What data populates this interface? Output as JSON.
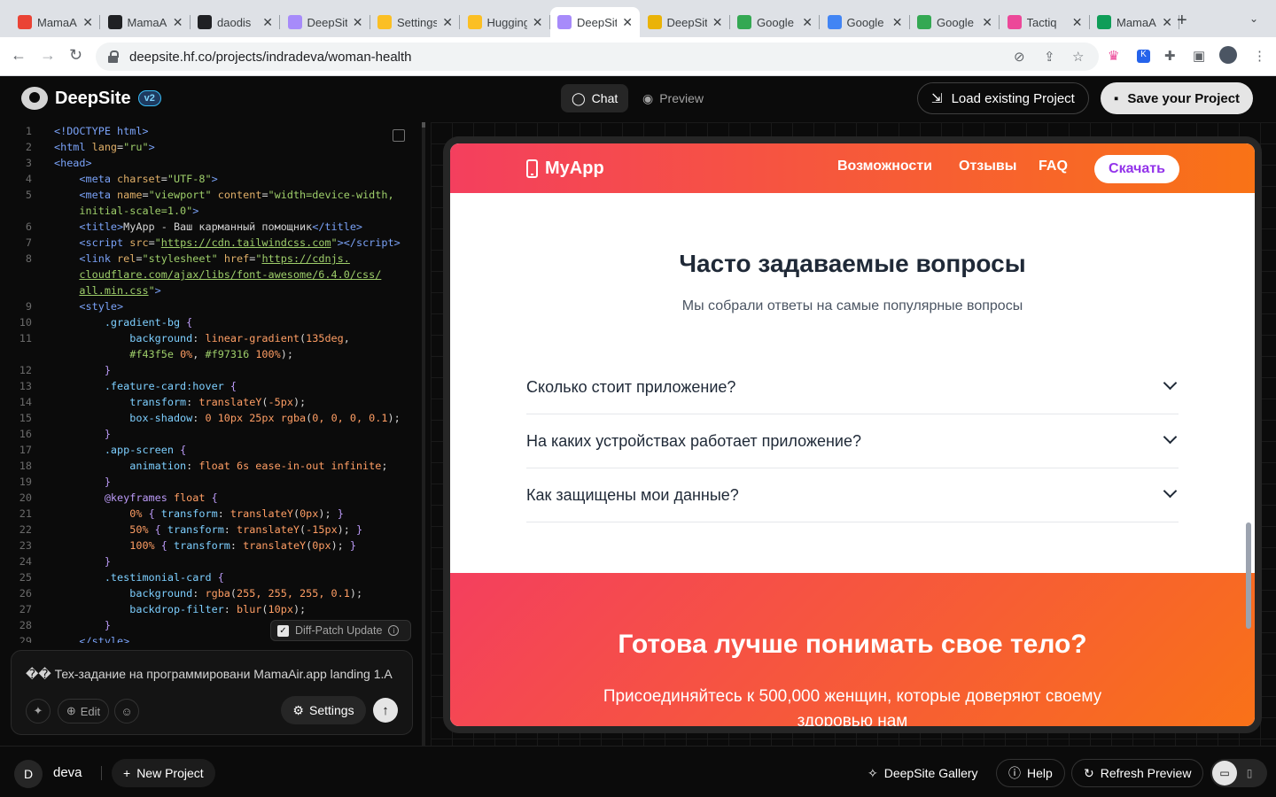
{
  "browser": {
    "tabs": [
      {
        "title": "MamaAir",
        "fav_color": "#ea4335",
        "fav_icon": "figma-icon"
      },
      {
        "title": "MamaAir",
        "fav_color": "#202124",
        "fav_icon": "openai-icon"
      },
      {
        "title": "daodis",
        "fav_color": "#202124",
        "fav_icon": "openai-icon"
      },
      {
        "title": "DeepSite",
        "fav_color": "#a78bfa",
        "fav_icon": "deepsite-icon"
      },
      {
        "title": "Settings",
        "fav_color": "#fbbf24",
        "fav_icon": "huggingface-icon"
      },
      {
        "title": "Hugging Face",
        "fav_color": "#fbbf24",
        "fav_icon": "huggingface-icon"
      },
      {
        "title": "DeepSite",
        "fav_color": "#a78bfa",
        "fav_icon": "deepsite-icon"
      },
      {
        "title": "DeepSite",
        "fav_color": "#eab308",
        "fav_icon": "deepsite-icon"
      },
      {
        "title": "Google Meet",
        "fav_color": "#34a853",
        "fav_icon": "meet-icon"
      },
      {
        "title": "Google Calendar",
        "fav_color": "#4285f4",
        "fav_icon": "calendar-icon"
      },
      {
        "title": "Google Meet",
        "fav_color": "#34a853",
        "fav_icon": "meet-icon"
      },
      {
        "title": "Tactiq",
        "fav_color": "#ec4899",
        "fav_icon": "tactiq-icon"
      },
      {
        "title": "MamaAir",
        "fav_color": "#0f9d58",
        "fav_icon": "drive-icon"
      }
    ],
    "url": "deepsite.hf.co/projects/indradeva/woman-health"
  },
  "app": {
    "name": "DeepSite",
    "version": "v2",
    "chat_label": "Chat",
    "preview_label": "Preview",
    "load_label": "Load existing Project",
    "save_label": "Save your Project"
  },
  "editor": {
    "lines": [
      {
        "n": "1",
        "html": "<span class='ck'>&lt;!DOCTYPE html&gt;</span>"
      },
      {
        "n": "2",
        "html": "<span class='ck'>&lt;html</span> <span class='ca'>lang</span>=<span class='cs'>\"ru\"</span><span class='ck'>&gt;</span>"
      },
      {
        "n": "3",
        "html": "<span class='ck'>&lt;head&gt;</span>"
      },
      {
        "n": "4",
        "html": "    <span class='ck'>&lt;meta</span> <span class='ca'>charset</span>=<span class='cs'>\"UTF-8\"</span><span class='ck'>&gt;</span>"
      },
      {
        "n": "5",
        "html": "    <span class='ck'>&lt;meta</span> <span class='ca'>name</span>=<span class='cs'>\"viewport\"</span> <span class='ca'>content</span>=<span class='cs'>\"width=device-width,</span>"
      },
      {
        "n": "",
        "html": "    <span class='cs'>initial-scale=1.0\"</span><span class='ck'>&gt;</span>"
      },
      {
        "n": "6",
        "html": "    <span class='ck'>&lt;title&gt;</span>MyApp - Ваш карманный помощник<span class='ck'>&lt;/title&gt;</span>"
      },
      {
        "n": "7",
        "html": "    <span class='ck'>&lt;script</span> <span class='ca'>src</span>=<span class='cs'>\"<u>https://cdn.tailwindcss.com</u>\"</span><span class='ck'>&gt;&lt;/script&gt;</span>"
      },
      {
        "n": "8",
        "html": "    <span class='ck'>&lt;link</span> <span class='ca'>rel</span>=<span class='cs'>\"stylesheet\"</span> <span class='ca'>href</span>=<span class='cs'>\"<u>https://cdnjs.</u></span>"
      },
      {
        "n": "",
        "html": "    <span class='cs'><u>cloudflare.com/ajax/libs/font-awesome/6.4.0/css/</u></span>"
      },
      {
        "n": "",
        "html": "    <span class='cs'><u>all.min.css</u>\"</span><span class='ck'>&gt;</span>"
      },
      {
        "n": "9",
        "html": "    <span class='ck'>&lt;style&gt;</span>"
      },
      {
        "n": "10",
        "html": "        <span class='cc'>.gradient-bg</span> <span class='cp'>{</span>"
      },
      {
        "n": "11",
        "html": "            <span class='cc'>background</span>: <span class='cv'>linear-gradient</span>(<span class='cv'>135deg</span>,"
      },
      {
        "n": "",
        "html": "            <span class='cs'>#f43f5e</span> <span class='cv'>0%</span>, <span class='cs'>#f97316</span> <span class='cv'>100%</span>);"
      },
      {
        "n": "12",
        "html": "        <span class='cp'>}</span>"
      },
      {
        "n": "13",
        "html": "        <span class='cc'>.feature-card:hover</span> <span class='cp'>{</span>"
      },
      {
        "n": "14",
        "html": "            <span class='cc'>transform</span>: <span class='cv'>translateY</span>(<span class='cv'>-5px</span>);"
      },
      {
        "n": "15",
        "html": "            <span class='cc'>box-shadow</span>: <span class='cv'>0 10px 25px</span> <span class='cv'>rgba</span>(<span class='cv'>0, 0, 0, 0.1</span>);"
      },
      {
        "n": "16",
        "html": "        <span class='cp'>}</span>"
      },
      {
        "n": "17",
        "html": "        <span class='cc'>.app-screen</span> <span class='cp'>{</span>"
      },
      {
        "n": "18",
        "html": "            <span class='cc'>animation</span>: <span class='cv'>float 6s ease-in-out infinite</span>;"
      },
      {
        "n": "19",
        "html": "        <span class='cp'>}</span>"
      },
      {
        "n": "20",
        "html": "        <span class='cp'>@keyframes</span> <span class='cv'>float</span> <span class='cp'>{</span>"
      },
      {
        "n": "21",
        "html": "            <span class='cv'>0%</span> <span class='cp'>{</span> <span class='cc'>transform</span>: <span class='cv'>translateY</span>(<span class='cv'>0px</span>); <span class='cp'>}</span>"
      },
      {
        "n": "22",
        "html": "            <span class='cv'>50%</span> <span class='cp'>{</span> <span class='cc'>transform</span>: <span class='cv'>translateY</span>(<span class='cv'>-15px</span>); <span class='cp'>}</span>"
      },
      {
        "n": "23",
        "html": "            <span class='cv'>100%</span> <span class='cp'>{</span> <span class='cc'>transform</span>: <span class='cv'>translateY</span>(<span class='cv'>0px</span>); <span class='cp'>}</span>"
      },
      {
        "n": "24",
        "html": "        <span class='cp'>}</span>"
      },
      {
        "n": "25",
        "html": "        <span class='cc'>.testimonial-card</span> <span class='cp'>{</span>"
      },
      {
        "n": "26",
        "html": "            <span class='cc'>background</span>: <span class='cv'>rgba</span>(<span class='cv'>255, 255, 255, 0.1</span>);"
      },
      {
        "n": "27",
        "html": "            <span class='cc'>backdrop-filter</span>: <span class='cv'>blur</span>(<span class='cv'>10px</span>);"
      },
      {
        "n": "28",
        "html": "        <span class='cp'>}</span>"
      },
      {
        "n": "29",
        "html": "    <span class='ck'>&lt;/style&gt;</span>"
      }
    ],
    "diff_patch_label": "Diff-Patch Update"
  },
  "chat": {
    "input_value": "�� Тех-задание на программировани MamaAir.app landing 1.A",
    "edit_label": "Edit",
    "settings_label": "Settings"
  },
  "site": {
    "logo": "MyApp",
    "nav": [
      "Возможности",
      "Отзывы",
      "FAQ"
    ],
    "download_label": "Скачать",
    "faq_title": "Часто задаваемые вопросы",
    "faq_subtitle": "Мы собрали ответы на самые популярные вопросы",
    "faq": [
      "Сколько стоит приложение?",
      "На каких устройствах работает приложение?",
      "Как защищены мои данные?"
    ],
    "cta_title": "Готова лучше понимать свое тело?",
    "cta_text": "Присоединяйтесь к 500,000 женщин, которые доверяют своему здоровью нам",
    "gradient_from": "#f43f5e",
    "gradient_to": "#f97316"
  },
  "footer": {
    "avatar": "D",
    "user": "deva",
    "new_project": "New Project",
    "gallery": "DeepSite Gallery",
    "help": "Help",
    "refresh": "Refresh Preview"
  }
}
